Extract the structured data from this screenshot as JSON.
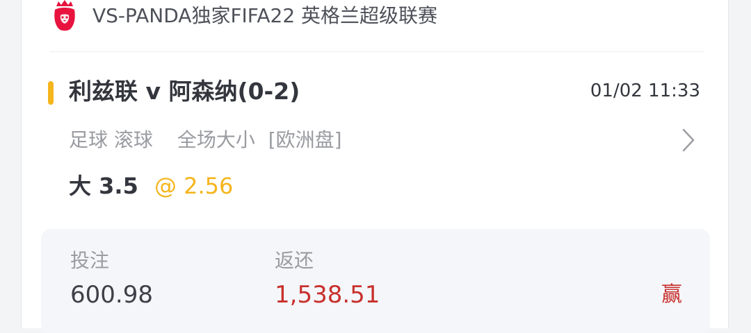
{
  "colors": {
    "accent": "#f5b51c",
    "win": "#c8302c",
    "text_primary": "#33363d",
    "text_secondary": "#999ba0",
    "league_logo": "#e8143f"
  },
  "header": {
    "league_icon": "premier-league-lion-icon",
    "league_title": "VS-PANDA独家FIFA22 英格兰超级联赛"
  },
  "match": {
    "name": "利兹联 v 阿森纳(0-2)",
    "time": "01/02 11:33"
  },
  "bet": {
    "sport": "足球 滚球",
    "market": "全场大小",
    "odds_type": "[欧洲盘]",
    "pick": "大 3.5",
    "odds": "@ 2.56",
    "detail_icon": "chevron-right-icon"
  },
  "summary": {
    "stake_label": "投注",
    "stake_value": "600.98",
    "return_label": "返还",
    "return_value": "1,538.51",
    "result": "赢"
  }
}
